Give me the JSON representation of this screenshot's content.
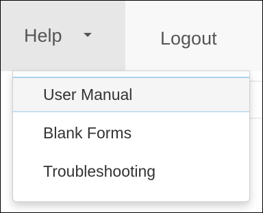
{
  "navbar": {
    "help_label": "Help",
    "logout_label": "Logout"
  },
  "dropdown": {
    "items": [
      {
        "label": "User Manual"
      },
      {
        "label": "Blank Forms"
      },
      {
        "label": "Troubleshooting"
      }
    ]
  },
  "colors": {
    "nav_background": "#f8f8f8",
    "active_nav_background": "#e7e7e7",
    "nav_text": "#555555",
    "menu_text": "#333333",
    "hover_item_background": "#f5f5f5",
    "focus_outline": "#a8d0ea"
  }
}
